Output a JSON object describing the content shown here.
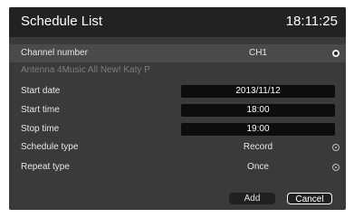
{
  "header": {
    "title": "Schedule List",
    "clock": "18:11:25"
  },
  "rows": {
    "channel": {
      "label": "Channel number",
      "value": "CH1"
    },
    "program": {
      "label": "Antenna 4Music All New! Katy P"
    },
    "start_date": {
      "label": "Start date",
      "value": "2013/11/12"
    },
    "start_time": {
      "label": "Start time",
      "value": "18:00"
    },
    "stop_time": {
      "label": "Stop time",
      "value": "19:00"
    },
    "schedule_type": {
      "label": "Schedule type",
      "value": "Record"
    },
    "repeat_type": {
      "label": "Repeat type",
      "value": "Once"
    }
  },
  "buttons": {
    "add": "Add",
    "cancel": "Cancel"
  },
  "colors": {
    "panel_bg": "#3a3a3a",
    "title_bar_bg": "#222222",
    "highlight_row_bg": "#4a4a4a",
    "field_bg": "#0d0d0d"
  }
}
